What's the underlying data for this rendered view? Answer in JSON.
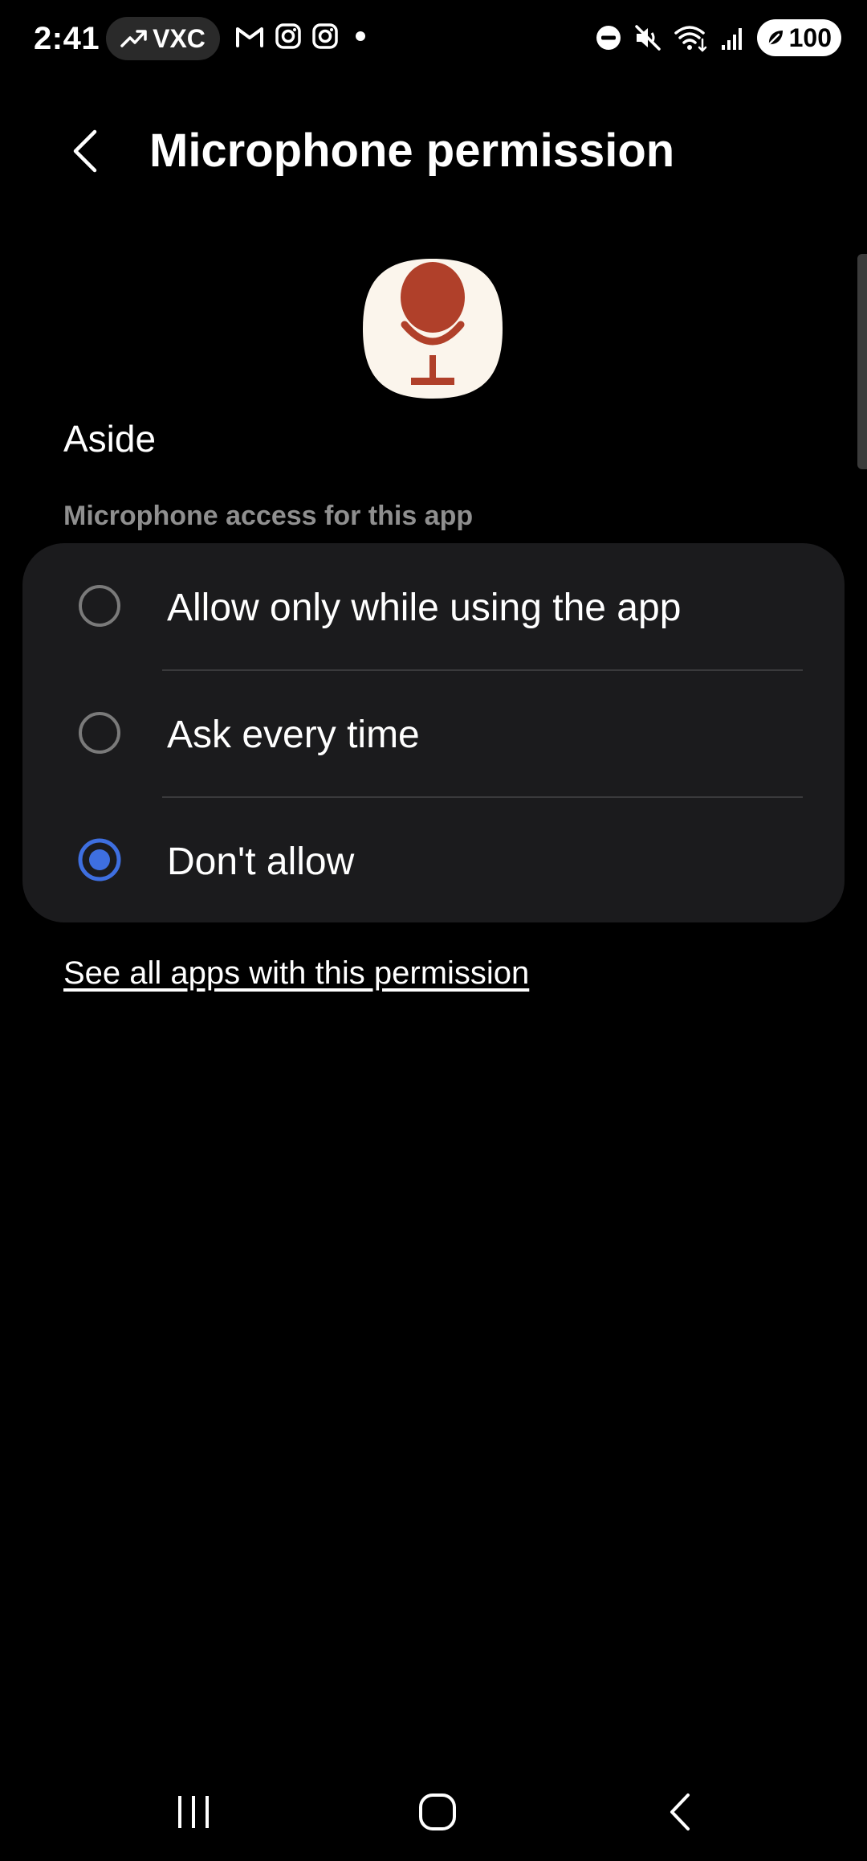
{
  "status_bar": {
    "time": "2:41",
    "pill_label": "VXC",
    "battery_level": "100",
    "icons": [
      "trending-up-icon",
      "gmail-icon",
      "instagram-icon",
      "instagram-icon",
      "dot-icon",
      "do-not-disturb-icon",
      "mute-icon",
      "wifi-icon",
      "signal-icon",
      "battery-saver-icon"
    ]
  },
  "header": {
    "title": "Microphone permission",
    "back_icon": "back-chevron-icon"
  },
  "app": {
    "name": "Aside",
    "icon": "microphone-app-icon"
  },
  "permission": {
    "section_label": "Microphone access for this app",
    "options": [
      {
        "label": "Allow only while using the app",
        "selected": false
      },
      {
        "label": "Ask every time",
        "selected": false
      },
      {
        "label": "Don't allow",
        "selected": true
      }
    ]
  },
  "link": {
    "label": "See all apps with this permission"
  },
  "nav_bar": {
    "icons": [
      "recent-apps-icon",
      "home-icon",
      "back-icon"
    ]
  },
  "colors": {
    "background": "#000000",
    "card": "#1b1b1d",
    "accent_radio": "#3e6fe0",
    "section_label": "#8f8f8f",
    "app_icon_bg": "#fbf5ec",
    "app_icon_accent": "#b0402a"
  }
}
